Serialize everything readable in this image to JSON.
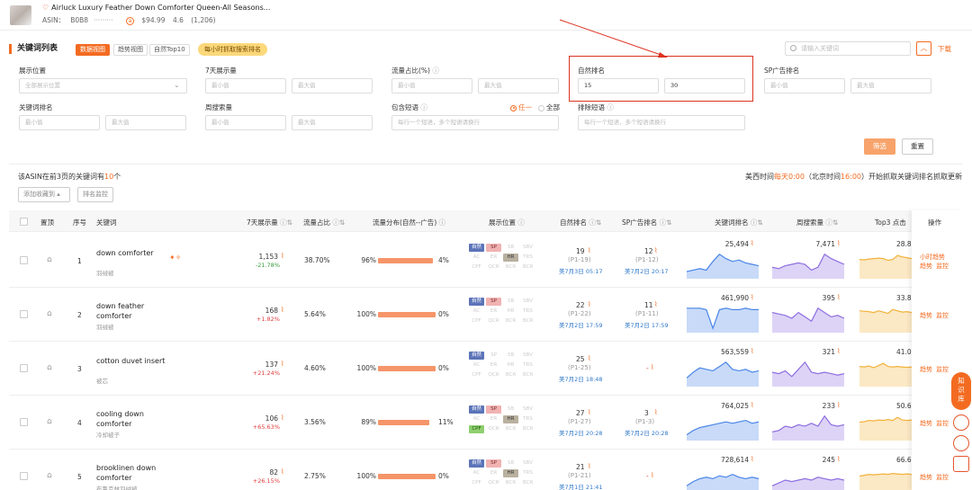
{
  "product": {
    "title": "Airluck Luxury Feather Down Comforter Queen-All Seasons...",
    "asin_label": "ASIN：",
    "asin": "B0B8",
    "price": "$94.99",
    "rating": "4.6",
    "reviews": "(1,206)"
  },
  "section": {
    "title": "关键词列表",
    "tabs": [
      "数据视图",
      "趋势视图",
      "自然Top10"
    ],
    "badge": "每小时抓取搜索排名",
    "search_placeholder": "请输入关键词",
    "collapse_icon": "chevron-up-icon",
    "download": "下载"
  },
  "filters": {
    "display_pos": {
      "label": "展示位置",
      "placeholder": "全部展示位置"
    },
    "impressions": {
      "label": "7天展示量",
      "min": "最小值",
      "max": "最大值"
    },
    "traffic_share": {
      "label": "流量占比(%)",
      "min": "最小值",
      "max": "最大值"
    },
    "organic_rank": {
      "label": "自然排名",
      "min": "15",
      "max": "30"
    },
    "sp_rank": {
      "label": "SP广告排名",
      "min": "最小值",
      "max": "最大值"
    },
    "kw_rank": {
      "label": "关键词排名",
      "min": "最小值",
      "max": "最大值"
    },
    "weekly_search": {
      "label": "周搜索量",
      "min": "最小值",
      "max": "最大值"
    },
    "include": {
      "label": "包含短语",
      "opt_any": "任一",
      "opt_all": "全部",
      "placeholder": "每行一个短语，多个短语请换行"
    },
    "exclude": {
      "label": "排除短语",
      "placeholder": "每行一个短语，多个短语请换行"
    },
    "filter_btn": "筛选",
    "reset_btn": "重置"
  },
  "summary": {
    "prefix": "该ASIN在前3页的关键词有",
    "count": "10",
    "suffix": "个",
    "note_a": "美西时间",
    "note_b": "每天0:00",
    "note_c": "（北京时间",
    "note_d": "16:00",
    "note_e": "）开始抓取关键词排名抓取更新",
    "add_btn": "添加收藏到",
    "monitor_btn": "排名监控"
  },
  "headers": [
    "置顶",
    "序号",
    "关键词",
    "7天展示量",
    "流量占比",
    "流量分布(自然--广告)",
    "展示位置",
    "自然排名",
    "SP广告排名",
    "关键词排名",
    "周搜索量",
    "Top3 点击",
    "操作"
  ],
  "positions": [
    "自然",
    "SP",
    "SB",
    "SBV",
    "AC",
    "ER",
    "HR",
    "TRS",
    "CPF",
    "QCR",
    "BCR",
    "BCR"
  ],
  "rows": [
    {
      "idx": "1",
      "kw": [
        "down comforter",
        ""
      ],
      "kw_cn": "羽绒被",
      "imp": "1,153",
      "chg": "-21.78%",
      "chg_cls": "green",
      "share": "38.70%",
      "org_pct": "96%",
      "ad_pct": "4%",
      "org_frac": 0.96,
      "pos_on": [
        0,
        1,
        6
      ],
      "org_rank": "19",
      "org_sub": "(P1-19)",
      "org_time": "美7月3日 05:17",
      "sp_rank": "12",
      "sp_sub": "(P1-12)",
      "sp_time": "美7月2日 20:17",
      "kw_rank": "25,494",
      "week": "7,471",
      "top3": "28.8",
      "acts": [
        "小时趋势",
        "趋势",
        "监控"
      ],
      "spark1": [
        0.25,
        0.3,
        0.35,
        0.3,
        0.6,
        0.85,
        0.7,
        0.6,
        0.65,
        0.55,
        0.5,
        0.45
      ],
      "spark2": [
        0.4,
        0.35,
        0.45,
        0.5,
        0.55,
        0.5,
        0.3,
        0.4,
        0.85,
        0.7,
        0.6,
        0.5
      ]
    },
    {
      "idx": "2",
      "kw": [
        "down feather",
        "comforter"
      ],
      "kw_cn": "羽绒被",
      "imp": "168",
      "chg": "+1.82%",
      "chg_cls": "red",
      "share": "5.64%",
      "org_pct": "100%",
      "ad_pct": "0%",
      "org_frac": 1.0,
      "pos_on": [
        0,
        1
      ],
      "org_rank": "22",
      "org_sub": "(P1-22)",
      "org_time": "美7月2日 17:59",
      "sp_rank": "11",
      "sp_sub": "(P1-11)",
      "sp_time": "美7月2日 17:59",
      "kw_rank": "461,990",
      "week": "395",
      "top3": "33.8",
      "acts": [
        "趋势",
        "监控"
      ],
      "spark1": [
        0.85,
        0.85,
        0.85,
        0.8,
        0.15,
        0.8,
        0.85,
        0.8,
        0.8,
        0.85,
        0.8,
        0.8
      ],
      "spark2": [
        0.7,
        0.65,
        0.6,
        0.5,
        0.7,
        0.55,
        0.4,
        0.85,
        0.7,
        0.55,
        0.6,
        0.5
      ]
    },
    {
      "idx": "3",
      "kw": [
        "cotton duvet insert",
        ""
      ],
      "kw_cn": "被芯",
      "imp": "137",
      "chg": "+21.24%",
      "chg_cls": "red",
      "share": "4.60%",
      "org_pct": "100%",
      "ad_pct": "0%",
      "org_frac": 1.0,
      "pos_on": [
        0
      ],
      "org_rank": "25",
      "org_sub": "(P1-25)",
      "org_time": "美7月2日 18:48",
      "sp_rank": "-",
      "sp_sub": "",
      "sp_time": "",
      "kw_rank": "563,559",
      "week": "321",
      "top3": "41.0",
      "acts": [
        "趋势",
        "监控"
      ],
      "spark1": [
        0.3,
        0.5,
        0.65,
        0.6,
        0.55,
        0.7,
        0.85,
        0.6,
        0.55,
        0.6,
        0.5,
        0.55
      ],
      "spark2": [
        0.5,
        0.45,
        0.55,
        0.35,
        0.6,
        0.85,
        0.5,
        0.45,
        0.5,
        0.45,
        0.4,
        0.45
      ]
    },
    {
      "idx": "4",
      "kw": [
        "cooling down",
        "comforter"
      ],
      "kw_cn": "冷却被子",
      "imp": "106",
      "chg": "+65.63%",
      "chg_cls": "red",
      "share": "3.56%",
      "org_pct": "89%",
      "ad_pct": "11%",
      "org_frac": 0.89,
      "pos_on": [
        0,
        1,
        6,
        8
      ],
      "org_rank": "27",
      "org_sub": "(P1-27)",
      "org_time": "美7月2日 20:28",
      "sp_rank": "3",
      "sp_sub": "(P1-3)",
      "sp_time": "美7月2日 20:28",
      "kw_rank": "764,025",
      "week": "233",
      "top3": "50.6",
      "acts": [
        "趋势",
        "监控"
      ],
      "spark1": [
        0.2,
        0.35,
        0.45,
        0.5,
        0.55,
        0.6,
        0.65,
        0.6,
        0.65,
        0.7,
        0.6,
        0.65
      ],
      "spark2": [
        0.3,
        0.35,
        0.5,
        0.45,
        0.55,
        0.5,
        0.6,
        0.5,
        0.85,
        0.55,
        0.5,
        0.55
      ]
    },
    {
      "idx": "5",
      "kw": [
        "brooklinen down",
        "comforter"
      ],
      "kw_cn": "布鲁克林羽绒被",
      "imp": "82",
      "chg": "+26.15%",
      "chg_cls": "red",
      "share": "2.75%",
      "org_pct": "100%",
      "ad_pct": "0%",
      "org_frac": 1.0,
      "pos_on": [
        0,
        1,
        6
      ],
      "org_rank": "21",
      "org_sub": "(P1-21)",
      "org_time": "美7月1日 21:41",
      "sp_rank": "-",
      "sp_sub": "",
      "sp_time": "",
      "kw_rank": "728,614",
      "week": "245",
      "top3": "66.6",
      "acts": [
        "趋势",
        "监控"
      ],
      "spark1": [
        0.3,
        0.45,
        0.55,
        0.6,
        0.55,
        0.65,
        0.6,
        0.7,
        0.6,
        0.55,
        0.6,
        0.55
      ],
      "spark2": [
        0.3,
        0.4,
        0.5,
        0.45,
        0.5,
        0.55,
        0.5,
        0.6,
        0.55,
        0.5,
        0.55,
        0.5
      ]
    }
  ],
  "float": {
    "kb": "知识库"
  },
  "colors": {
    "accent": "#f36b21",
    "blue_spark": "#4a86e8",
    "purple_spark": "#8e6ee0",
    "yellow_spark": "#f2b23a"
  }
}
